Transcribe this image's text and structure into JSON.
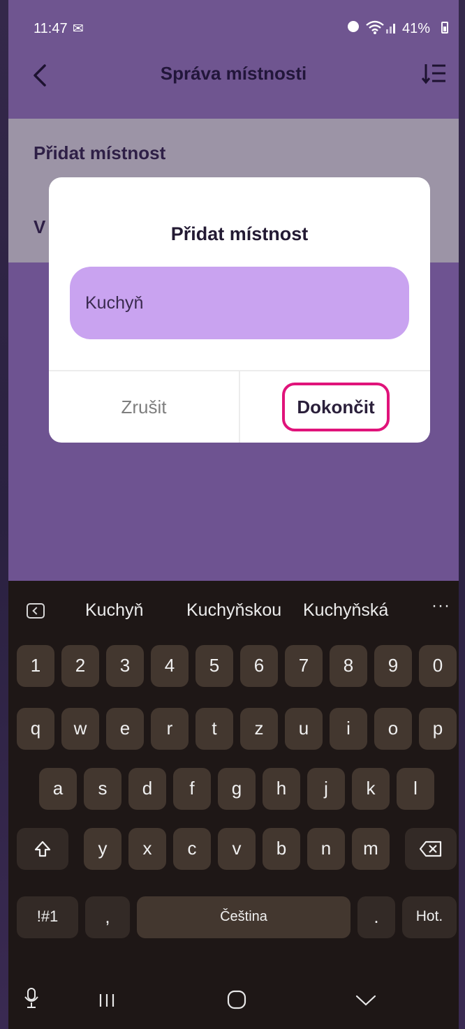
{
  "status_bar": {
    "time": "11:47",
    "battery": "41%"
  },
  "header": {
    "title": "Správa místnosti"
  },
  "list": {
    "add_room": "Přidat místnost",
    "second_item_visible": "V"
  },
  "dialog": {
    "title": "Přidat místnost",
    "input_value": "Kuchyň",
    "cancel_label": "Zrušit",
    "confirm_label": "Dokončit",
    "highlight_color": "#e0137a"
  },
  "keyboard": {
    "suggestions": [
      "Kuchyň",
      "Kuchyňskou",
      "Kuchyňská"
    ],
    "more": "···",
    "row_numbers": [
      "1",
      "2",
      "3",
      "4",
      "5",
      "6",
      "7",
      "8",
      "9",
      "0"
    ],
    "row_1": [
      "q",
      "w",
      "e",
      "r",
      "t",
      "z",
      "u",
      "i",
      "o",
      "p"
    ],
    "row_2": [
      "a",
      "s",
      "d",
      "f",
      "g",
      "h",
      "j",
      "k",
      "l"
    ],
    "row_3": [
      "y",
      "x",
      "c",
      "v",
      "b",
      "n",
      "m"
    ],
    "symbols_key": "!#1",
    "comma_key": ",",
    "space_label": "Čeština",
    "period_key": ".",
    "done_key": "Hot."
  },
  "colors": {
    "app_bg": "#6e5391",
    "dialog_input": "#c9a3f0",
    "keyboard_bg": "#1e1716",
    "key_bg": "#43372f"
  }
}
